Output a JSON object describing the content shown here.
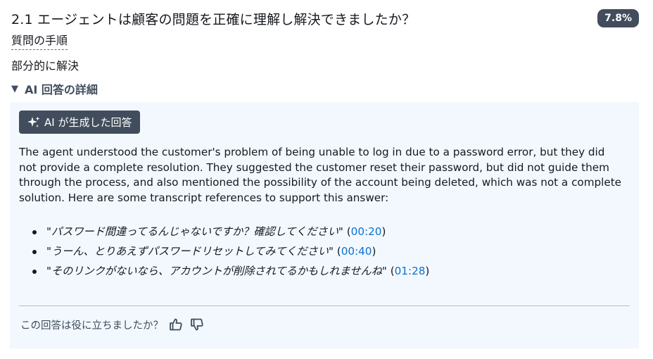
{
  "question": {
    "title": "2.1 エージェントは顧客の問題を正確に理解し解決できましたか？",
    "score": "7.8%",
    "procedure_label": "質問の手順",
    "answer": "部分的に解決"
  },
  "details": {
    "toggle_label": "AI 回答の詳細",
    "caret": "▼",
    "ai_badge_label": "AI が生成した回答",
    "summary": "The agent understood the customer's problem of being unable to log in due to a password error, but they did not provide a complete resolution. They suggested the customer reset their password, but did not guide them through the process, and also mentioned the possibility of the account being deleted, which was not a complete solution. Here are some transcript references to support this answer:",
    "references": [
      {
        "quote": "\"パスワード間違ってるんじゃないですか？確認してください\"",
        "timestamp": "00:20"
      },
      {
        "quote": "\"うーん、とりあえずパスワードリセットしてみてください\"",
        "timestamp": "00:40"
      },
      {
        "quote": "\"そのリンクがないなら、アカウントが削除されてるかもしれませんね\"",
        "timestamp": "01:28"
      }
    ]
  },
  "feedback": {
    "prompt": "この回答は役に立ちましたか？"
  },
  "colors": {
    "badge_bg": "#414d5c",
    "panel_bg": "#f2f8fd",
    "link": "#0972d3"
  }
}
